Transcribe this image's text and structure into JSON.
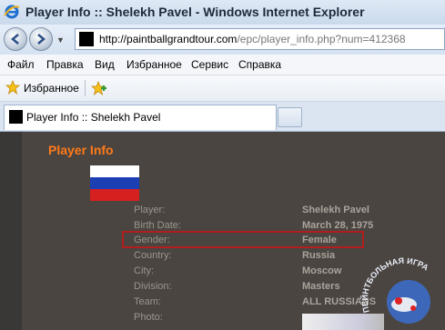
{
  "window": {
    "title": "Player Info :: Shelekh Pavel - Windows Internet Explorer"
  },
  "address": {
    "domain": "http://paintballgrandtour.com",
    "path": "/epc/player_info.php?num=412368"
  },
  "menu": {
    "items": [
      "Файл",
      "Правка",
      "Вид",
      "Избранное",
      "Сервис",
      "Справка"
    ]
  },
  "favorites": {
    "label": "Избранное"
  },
  "tab": {
    "label": "Player Info :: Shelekh Pavel"
  },
  "page": {
    "title": "Player Info",
    "rows": [
      {
        "label": "Player:",
        "value": "Shelekh Pavel"
      },
      {
        "label": "Birth Date:",
        "value": "March 28, 1975"
      },
      {
        "label": "Gender:",
        "value": "Female"
      },
      {
        "label": "Country:",
        "value": "Russia"
      },
      {
        "label": "City:",
        "value": "Moscow"
      },
      {
        "label": "Division:",
        "value": "Masters"
      },
      {
        "label": "Team:",
        "value": "ALL RUSSIANS"
      },
      {
        "label": "Photo:",
        "value": ""
      }
    ]
  },
  "watermark": {
    "text": "ПЕЙНТБОЛЬНАЯ ИГРА"
  },
  "colors": {
    "accent": "#ff7a1a",
    "highlight_border": "#b01e1e",
    "panel_bg": "#4a4541"
  },
  "icons": [
    "ie-icon",
    "back-arrow-icon",
    "forward-arrow-icon",
    "star-icon",
    "add-favorite-icon",
    "russia-flag-icon"
  ]
}
